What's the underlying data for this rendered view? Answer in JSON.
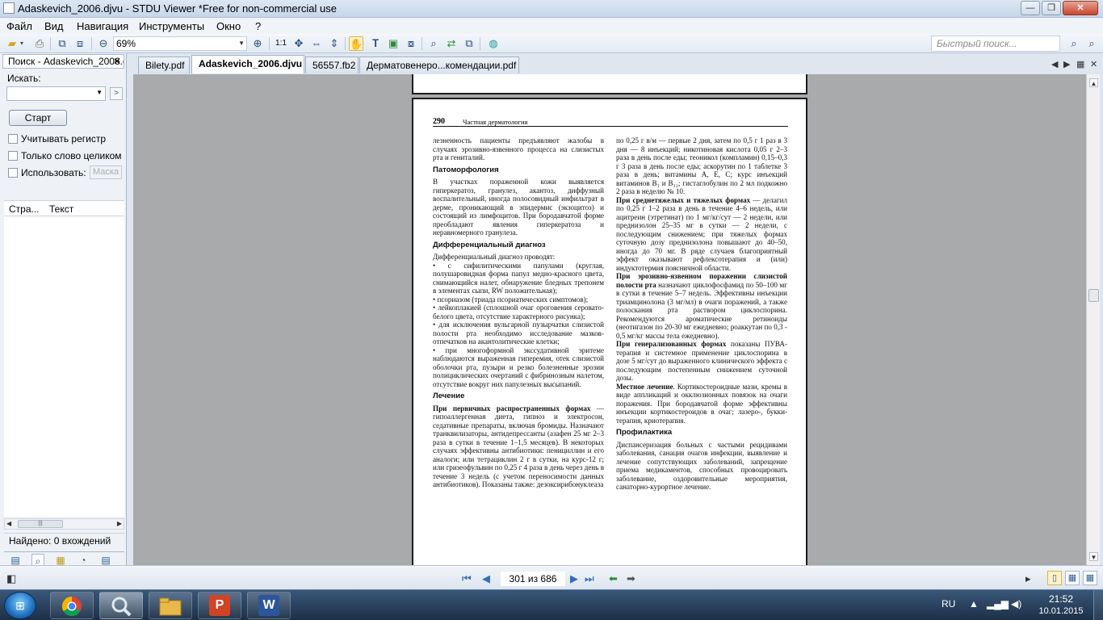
{
  "window": {
    "title": "Adaskevich_2006.djvu - STDU Viewer *Free for non-commercial use",
    "minimize": "—",
    "maximize": "❐",
    "close": "✕"
  },
  "menu": [
    "Файл",
    "Вид",
    "Навигация",
    "Инструменты",
    "Окно",
    "?"
  ],
  "toolbar": {
    "zoom_value": "69%",
    "quick_search_placeholder": "Быстрый поиск..."
  },
  "search_panel": {
    "title": "Поиск - Adaskevich_2006.djvu",
    "close": "✕",
    "search_label": "Искать:",
    "search_value": "",
    "start_button": "Старт",
    "case_label": "Учитывать регистр",
    "whole_word_label": "Только слово целиком",
    "use_label": "Использовать:",
    "use_value": "Маска",
    "col_page": "Стра...",
    "col_text": "Текст",
    "found": "Найдено: 0 вхождений"
  },
  "tabs": [
    "Bilety.pdf",
    "Adaskevich_2006.djvu",
    "56557.fb2",
    "Дерматовенеро...комендации.pdf"
  ],
  "active_tab": 1,
  "document": {
    "page_number": "290",
    "running_title": "Частная дерматология",
    "left": [
      {
        "t": "p",
        "text": "лезненность пациенты предъявляют жалобы в случаях эрозивно-язвенного процесса на слизистых рта и гениталий."
      },
      {
        "t": "h",
        "text": "Патоморфология"
      },
      {
        "t": "p",
        "text": "В участках пораженной кожи выявляется гиперкератоз, гранулез, акантоз, диффузный воспалительный, иногда полосовидный инфильтрат в дерме, проникающий в эпидермис (экзоцитоз) и состоящий из лимфоцитов. При бородавчатой форме преобладают явления гиперкератоза и неравномерного гранулеза."
      },
      {
        "t": "h",
        "text": "Дифференциальный диагноз"
      },
      {
        "t": "p",
        "text": "Дифференциальный диагноз проводят:"
      },
      {
        "t": "p",
        "text": "• с сифилитическими папулами (круглая, полушаровидная форма папул медно-красного цвета, снимающийся налет, обнаружение бледных трепонем в элементах сыпи, RW положительная);"
      },
      {
        "t": "p",
        "text": "• псориазом (триада псориатических симптомов);"
      },
      {
        "t": "p",
        "text": "• лейкоплакией (сплошной очаг ороговения серовато-белого цвета, отсутствие характерного рисунка);"
      },
      {
        "t": "p",
        "text": "• для исключения вульгарной пузырчатки слизистой полости рта необходимо исследование мазков-отпечатков на акантолитические клетки;"
      },
      {
        "t": "p",
        "text": "• при многоформной экссудативной эритеме наблюдаются выраженная гиперемия, отек слизистой оболочки рта, пузыри и резко болезненные эрозии полициклических очертаний с фибринозным налетом, отсутствие вокруг них папулезных высыпаний."
      },
      {
        "t": "h",
        "text": "Лечение"
      },
      {
        "t": "pb",
        "bold": "При первичных распространенных формах",
        "text": " — гипоаллергенная диета, гипноз и электросон, седативные препараты, включая бромиды. Назначают транквилизаторы, антидепрессанты (азафен 25 мг 2–3 раза в сутки в течение 1–1,5 месяцев). В некоторых случаях эффективны антибиотики: пенициллин и его аналоги; или тетрациклин 2 г в сутки, на курс-12 г; или гризеофульвин по 0,25 г 4 раза в день через день в течение 3 недель (с учетом переносимости данных антибиотиков). Показаны также: дезоксирибонуклеаза"
      }
    ],
    "right": [
      {
        "t": "p",
        "text": "по 0,25 г в/м — первые 2 дня, затем по 0,5 г 1 раз в 3 дня — 8 инъекций; никотиновая кислота 0,05 г 2–3 раза в день после еды; теоникол (компламин) 0,15–0,3 г 3 раза в день после еды; аскорутин по 1 таблетке 3 раза в день; витамины А, Е, С; курс инъекций витаминов B₁ и B₁₂; гистаглобулин по 2 мл подкожно 2 раза в неделю № 10."
      },
      {
        "t": "pb",
        "bold": "При среднетяжелых и тяжелых формах",
        "text": " — делагил по 0,25 г 1–2 раза в день в течение 4–6 недель, или ацитреин (этретинат) по 1 мг/кг/сут — 2 недели, или преднизолон 25–35 мг в сутки — 2 недели, с последующим снижением; при тяжелых формах суточную дозу преднизолона повышают до 40–50, иногда до 70 мг. В ряде случаев благоприятный эффект оказывают рефлексотерапия и (или) индуктотермия поясничной области."
      },
      {
        "t": "pb",
        "bold": "При эрозивно-язвенном поражении слизистой полости рта",
        "text": " назначают циклофосфамид по 50–100 мг в сутки в течение 5–7 недель. Эффективны инъекции триамцинолона (3 мг/мл) в очаги поражений, а также полоскания рта раствором циклоспорина. Рекомендуются ароматические ретиноиды (неотигазон по 20-30 мг ежедневно; роаккутан по 0,3 - 0,5 мг/кг массы тела ежедневно)."
      },
      {
        "t": "pb",
        "bold": "При генерализованных формах",
        "text": " показаны ПУВА-терапия и системное применение циклоспорина в дозе 5 мг/сут до выраженного клинического эффекта с последующим постепенным снижением суточной дозы."
      },
      {
        "t": "pb",
        "bold": "Местное лечение",
        "text": ". Кортикостероидные мази, кремы в виде аппликаций и окклюзионных повязок на очаги поражения. При бородавчатой форме эффективны инъекции кортикостероидов в очаг; лазеро-, букки-терапия, криотерапия."
      },
      {
        "t": "h",
        "text": "Профилактика"
      },
      {
        "t": "p",
        "text": "Диспансеризация больных с частыми рецидивами заболевания, санация очагов инфекции, выявление и лечение сопутствующих заболеваний, запрещение приема медикаментов, способных провоцировать заболевание, оздоровительные мероприятия, санаторно-курортное лечение."
      }
    ]
  },
  "status": {
    "page_indicator": "301 из 686"
  },
  "taskbar": {
    "apps": [
      "chrome",
      "stdu-viewer",
      "explorer",
      "powerpoint",
      "word"
    ],
    "powerpoint_letter": "P",
    "word_letter": "W",
    "lang": "RU",
    "time": "21:52",
    "date": "10.01.2015"
  }
}
